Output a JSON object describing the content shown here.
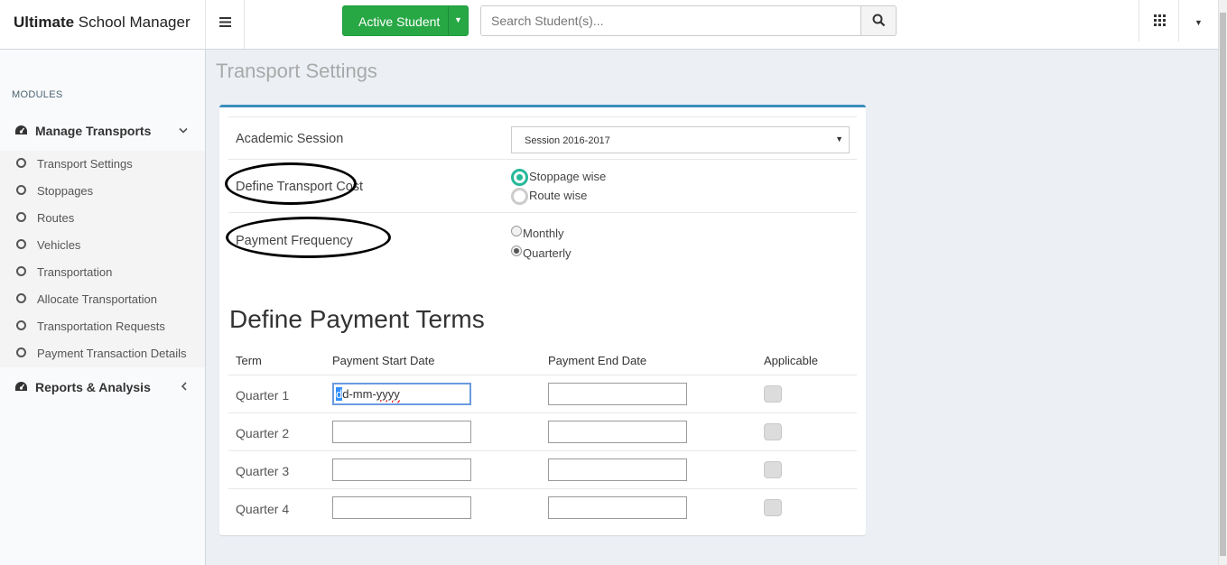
{
  "brand": {
    "bold": "Ultimate",
    "rest": " School Manager"
  },
  "topbar": {
    "active_button": "Active Student",
    "search_placeholder": "Search Student(s)..."
  },
  "sidebar": {
    "header": "MODULES",
    "manage": {
      "label": "Manage Transports",
      "items": [
        "Transport Settings",
        "Stoppages",
        "Routes",
        "Vehicles",
        "Transportation",
        "Allocate Transportation",
        "Transportation Requests",
        "Payment Transaction Details"
      ]
    },
    "reports": {
      "label": "Reports & Analysis"
    }
  },
  "page": {
    "title": "Transport Settings",
    "academic_session": {
      "label": "Academic Session",
      "value": "Session 2016-2017"
    },
    "transport_cost": {
      "label": "Define Transport Cost",
      "options": [
        "Stoppage wise",
        "Route wise"
      ],
      "selected": "Stoppage wise"
    },
    "payment_frequency": {
      "label": "Payment Frequency",
      "options": [
        "Monthly",
        "Quarterly"
      ],
      "selected": "Quarterly"
    },
    "terms": {
      "title": "Define Payment Terms",
      "headers": [
        "Term",
        "Payment Start Date",
        "Payment End Date",
        "Applicable"
      ],
      "rows": [
        {
          "term": "Quarter 1",
          "start_placeholder_first": "d",
          "start_placeholder_rest": "d-mm-",
          "start_placeholder_yyyy": "yyyy"
        },
        {
          "term": "Quarter 2"
        },
        {
          "term": "Quarter 3"
        },
        {
          "term": "Quarter 4"
        }
      ]
    }
  }
}
